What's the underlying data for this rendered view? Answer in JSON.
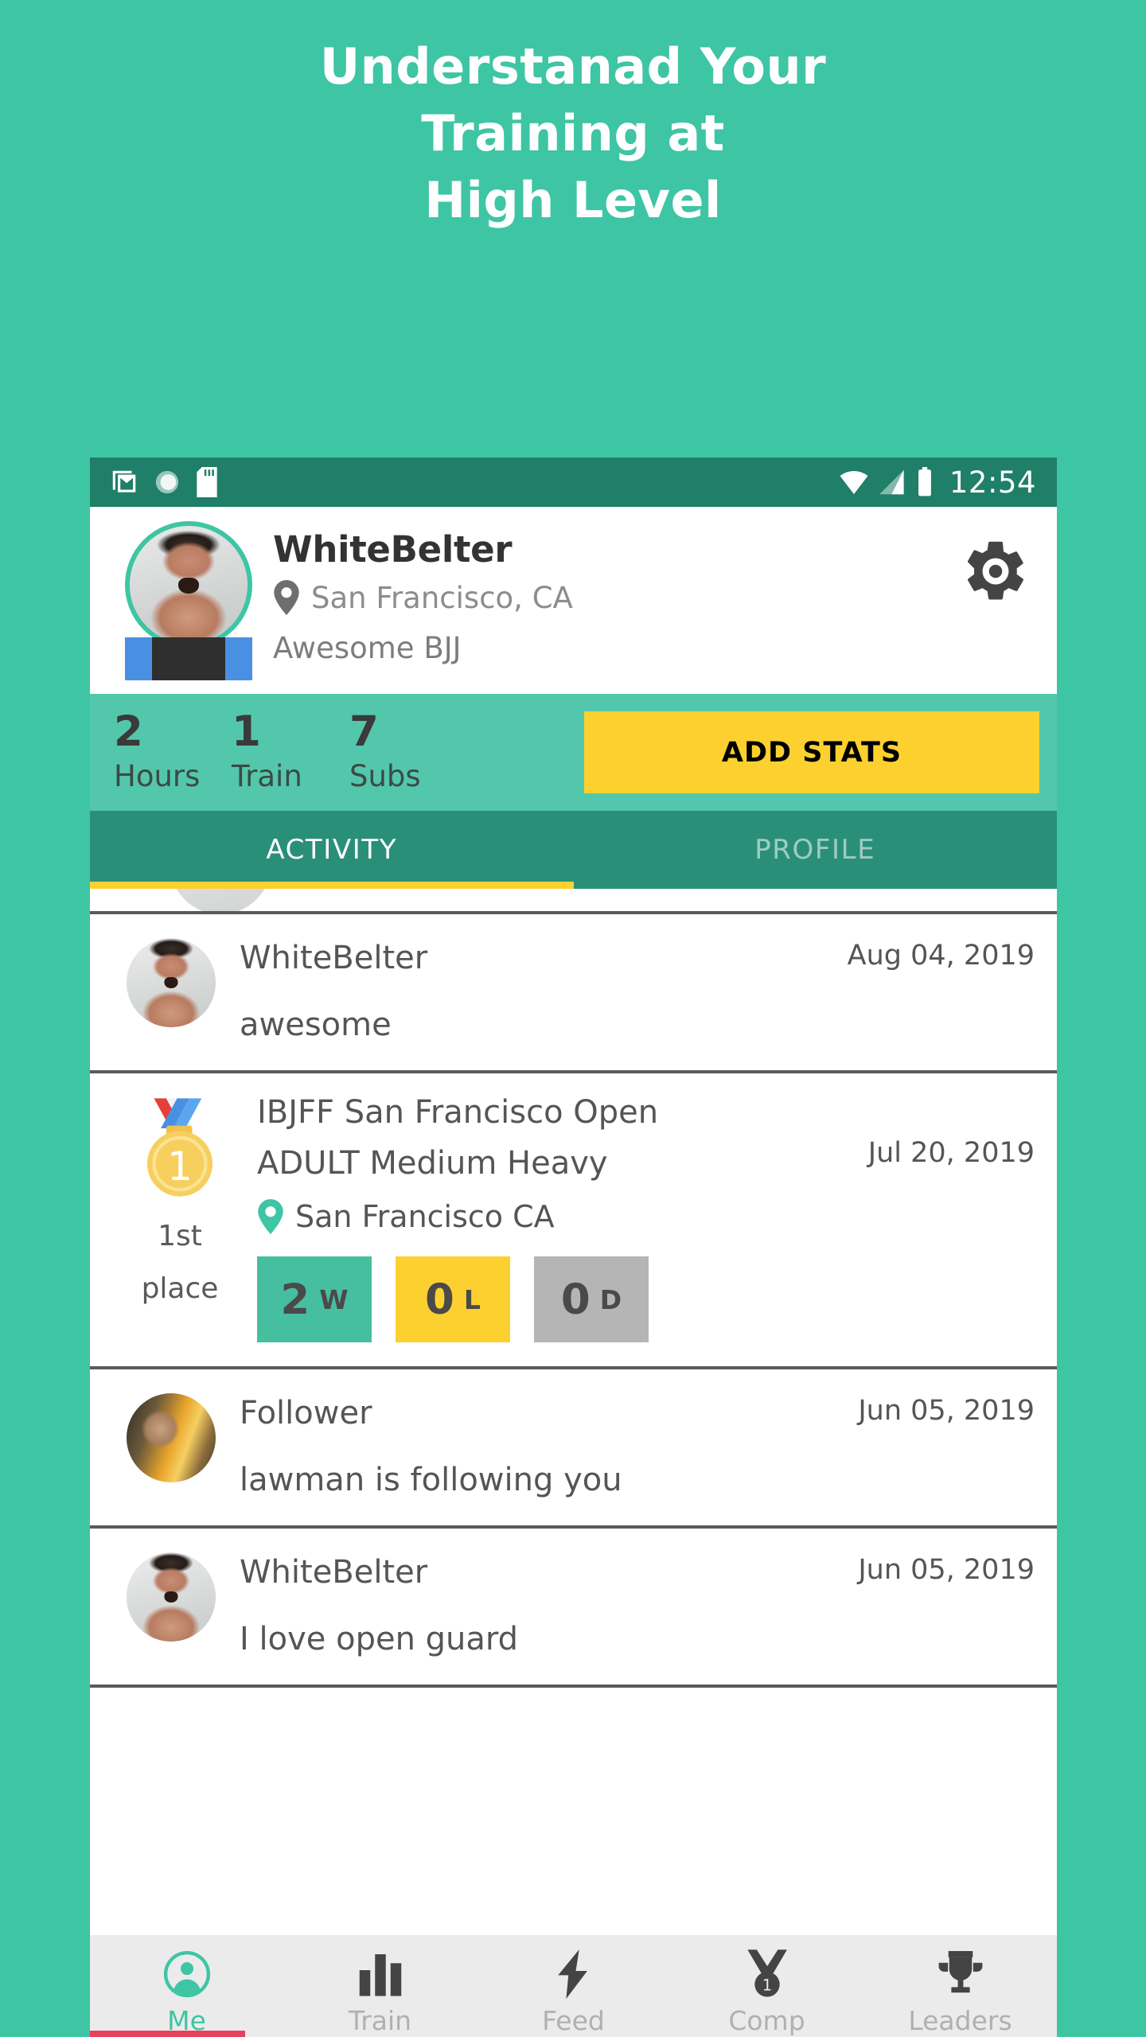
{
  "headline": {
    "lines": [
      "Understanad Your",
      "Training at",
      "High Level"
    ]
  },
  "colors": {
    "brand_teal": "#3ec5a4",
    "stats_teal": "#53c7ab",
    "tabbar_teal": "#2a8f79",
    "statusbar_teal": "#1f7f68",
    "accent_yellow": "#fcd12f",
    "draw_gray": "#b5b5b5",
    "underline_red": "#e8415c",
    "belt_blue": "#4a90e2"
  },
  "statusbar": {
    "time": "12:54",
    "left_icons": [
      "gmail-icon",
      "sync-circle-icon",
      "sd-card-icon"
    ],
    "right_icons": [
      "wifi-icon",
      "cell-signal-icon",
      "battery-icon"
    ]
  },
  "profile": {
    "username": "WhiteBelter",
    "location": "San Francisco, CA",
    "gym": "Awesome BJJ",
    "location_icon": "map-pin-icon",
    "settings_icon": "gear-icon",
    "avatar_icon": "profile-avatar",
    "belt_icon": "belt-rank-graphic"
  },
  "stats": {
    "items": [
      {
        "value": "2",
        "label": "Hours"
      },
      {
        "value": "1",
        "label": "Train"
      },
      {
        "value": "7",
        "label": "Subs"
      }
    ],
    "add_stats_label": "ADD STATS"
  },
  "tabs": [
    {
      "label": "ACTIVITY",
      "active": true
    },
    {
      "label": "PROFILE",
      "active": false
    }
  ],
  "feed": [
    {
      "type": "post",
      "title": "WhiteBelter",
      "date": "Aug 04, 2019",
      "text": "awesome",
      "avatar": "whitebelter-avatar"
    },
    {
      "type": "competition",
      "event": "IBJFF San Francisco Open",
      "division": "ADULT Medium Heavy",
      "date": "Jul 20, 2019",
      "location": "San Francisco CA",
      "location_icon": "map-pin-icon",
      "medal_icon": "gold-medal-icon",
      "place_line1": "1st",
      "place_line2": "place",
      "record": [
        {
          "value": "2",
          "letter": "W",
          "kind": "win"
        },
        {
          "value": "0",
          "letter": "L",
          "kind": "loss"
        },
        {
          "value": "0",
          "letter": "D",
          "kind": "draw"
        }
      ]
    },
    {
      "type": "post",
      "title": "Follower",
      "date": "Jun 05, 2019",
      "text": "lawman is following you",
      "avatar": "follower-avatar"
    },
    {
      "type": "post",
      "title": "WhiteBelter",
      "date": "Jun 05, 2019",
      "text": "I love open guard",
      "avatar": "whitebelter-avatar"
    }
  ],
  "bottom_nav": [
    {
      "label": "Me",
      "icon": "person-circle-icon",
      "active": true
    },
    {
      "label": "Train",
      "icon": "bar-chart-icon",
      "active": false
    },
    {
      "label": "Feed",
      "icon": "lightning-bolt-icon",
      "active": false
    },
    {
      "label": "Comp",
      "icon": "medal-icon",
      "active": false
    },
    {
      "label": "Leaders",
      "icon": "trophy-icon",
      "active": false
    }
  ]
}
